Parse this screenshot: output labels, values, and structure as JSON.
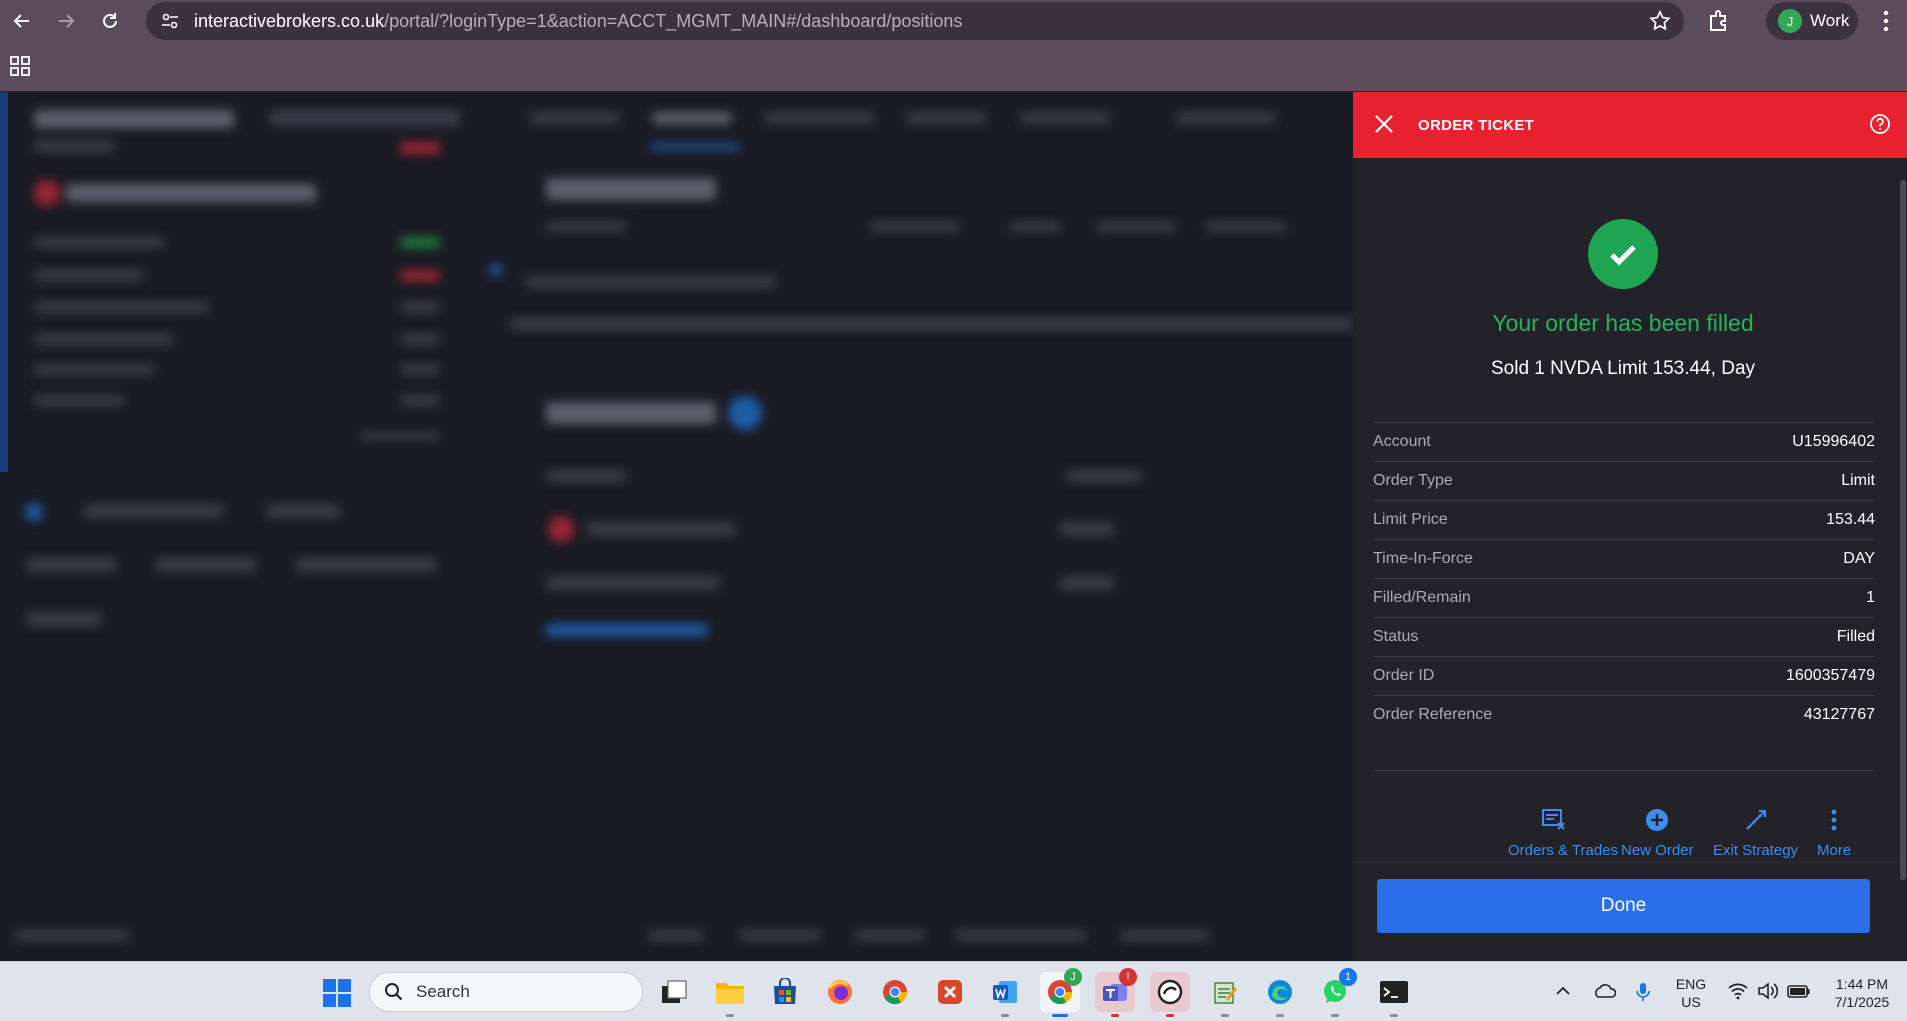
{
  "browser": {
    "url_host": "interactivebrokers.co.uk",
    "url_path": "/portal/?loginType=1&action=ACCT_MGMT_MAIN#/dashboard/positions",
    "profile_initial": "J",
    "profile_name": "Work"
  },
  "order_ticket": {
    "title": "ORDER TICKET",
    "status_message": "Your order has been filled",
    "summary": "Sold 1 NVDA Limit 153.44, Day",
    "details": [
      {
        "label": "Account",
        "value": "U15996402"
      },
      {
        "label": "Order Type",
        "value": "Limit"
      },
      {
        "label": "Limit Price",
        "value": "153.44"
      },
      {
        "label": "Time-In-Force",
        "value": "DAY"
      },
      {
        "label": "Filled/Remain",
        "value": "1"
      },
      {
        "label": "Status",
        "value": "Filled"
      },
      {
        "label": "Order ID",
        "value": "1600357479"
      },
      {
        "label": "Order Reference",
        "value": "43127767"
      }
    ],
    "actions": {
      "orders_trades": "Orders & Trades",
      "new_order": "New Order",
      "exit_strategy": "Exit Strategy",
      "more": "More"
    },
    "done_label": "Done",
    "colors": {
      "header": "#e8212e",
      "success": "#26b35e",
      "action": "#3b8ef0",
      "done": "#2c6ee8"
    }
  },
  "taskbar": {
    "search_label": "Search",
    "teams_badge": "!",
    "whatsapp_badge": "1",
    "chrome_badge": "J",
    "lang_line1": "ENG",
    "lang_line2": "US",
    "time": "1:44 PM",
    "date": "7/1/2025"
  }
}
